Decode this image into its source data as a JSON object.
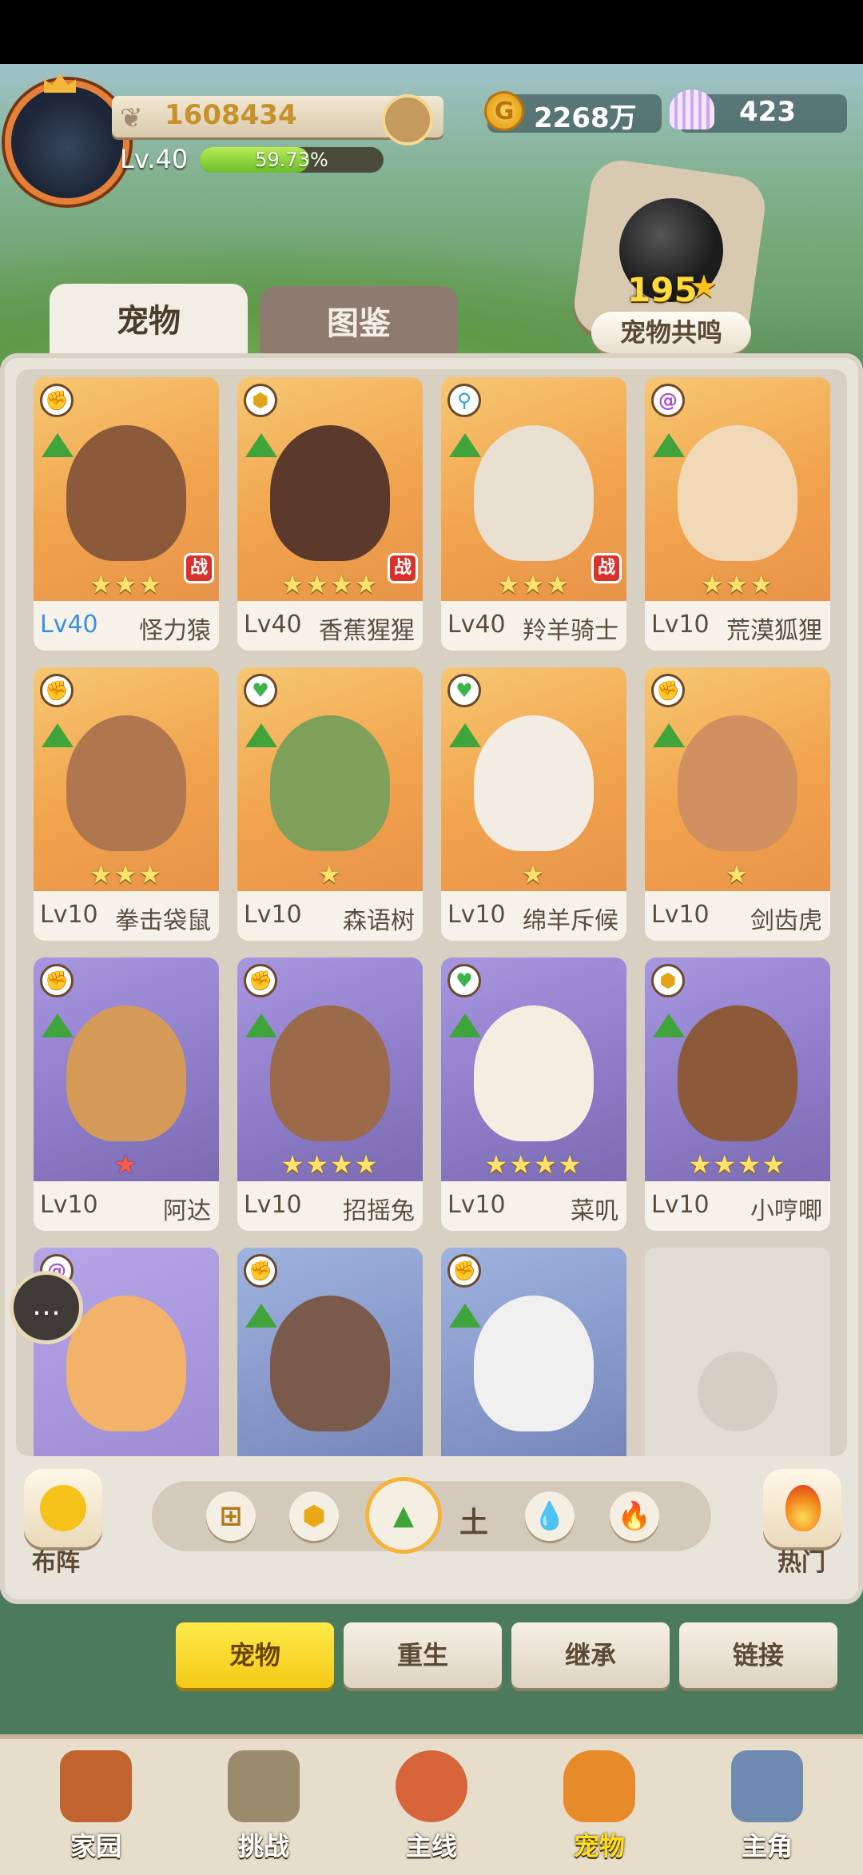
{
  "player": {
    "power": "1608434",
    "level_label": "Lv.40",
    "exp_text": "59.73%",
    "exp_fraction": 0.5973
  },
  "currency": {
    "coins": "2268万",
    "shells": "423"
  },
  "resonance": {
    "count": "195",
    "label": "宠物共鸣"
  },
  "tabs": [
    "宠物",
    "图鉴"
  ],
  "pets": [
    {
      "level": "Lv40",
      "name": "怪力猿",
      "stars": "★★★",
      "element": "✊",
      "tone": "gold",
      "element_color": "red",
      "battle": "战",
      "level_color": "blue"
    },
    {
      "level": "Lv40",
      "name": "香蕉猩猩",
      "stars": "★★★★",
      "element": "⬢",
      "tone": "gold",
      "element_color": "yellow",
      "battle": "战"
    },
    {
      "level": "Lv40",
      "name": "羚羊骑士",
      "stars": "★★★",
      "element": "⚲",
      "tone": "gold",
      "element_color": "cyan",
      "battle": "战"
    },
    {
      "level": "Lv10",
      "name": "荒漠狐狸",
      "stars": "★★★",
      "element": "@",
      "tone": "gold",
      "element_color": "violet"
    },
    {
      "level": "Lv10",
      "name": "拳击袋鼠",
      "stars": "★★★",
      "element": "✊",
      "tone": "gold",
      "element_color": "red"
    },
    {
      "level": "Lv10",
      "name": "森语树",
      "stars": "★",
      "element": "♥",
      "tone": "gold",
      "element_color": "green"
    },
    {
      "level": "Lv10",
      "name": "绵羊斥候",
      "stars": "★",
      "element": "♥",
      "tone": "gold",
      "element_color": "green"
    },
    {
      "level": "Lv10",
      "name": "剑齿虎",
      "stars": "★",
      "element": "✊",
      "tone": "gold",
      "element_color": "red"
    },
    {
      "level": "Lv10",
      "name": "阿达",
      "stars": "★",
      "element": "✊",
      "tone": "purple",
      "element_color": "red",
      "star_color": "red"
    },
    {
      "level": "Lv10",
      "name": "招摇兔",
      "stars": "★★★★",
      "element": "✊",
      "tone": "purple",
      "element_color": "red"
    },
    {
      "level": "Lv10",
      "name": "菜叽",
      "stars": "★★★★",
      "element": "♥",
      "tone": "purple",
      "element_color": "green"
    },
    {
      "level": "Lv10",
      "name": "小哼唧",
      "stars": "★★★★",
      "element": "⬢",
      "tone": "purple",
      "element_color": "yellow"
    },
    {
      "element": "@",
      "tone": "purple-light",
      "element_color": "violet"
    },
    {
      "element": "✊",
      "tone": "blue",
      "element_color": "red"
    },
    {
      "element": "✊",
      "tone": "blue",
      "element_color": "red"
    }
  ],
  "toolbar": {
    "lineup_label": "布阵",
    "hot_label": "热门",
    "earth_label": "土"
  },
  "filters": [
    {
      "name": "all",
      "icon": "⊞",
      "color": "#b07a1d"
    },
    {
      "name": "shield",
      "icon": "⬢",
      "color": "#e9a816"
    },
    {
      "name": "earth",
      "icon": "▲",
      "color": "#3fa53a",
      "selected": true
    },
    {
      "name": "water",
      "icon": "💧",
      "color": "#1f9fde"
    },
    {
      "name": "fire",
      "icon": "🔥",
      "color": "#e5452b"
    }
  ],
  "sub_nav": [
    "宠物",
    "重生",
    "继承",
    "链接"
  ],
  "bottom_nav": [
    "家园",
    "挑战",
    "主线",
    "宠物",
    "主角"
  ],
  "colors": {
    "accent_yellow": "#f3c916",
    "card_gold": "#f1a34d",
    "card_purple": "#8c7bc7"
  }
}
